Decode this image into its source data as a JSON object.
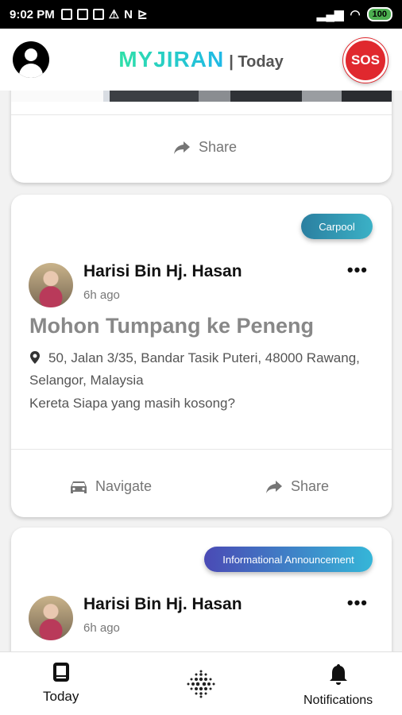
{
  "status_bar": {
    "time": "9:02 PM",
    "battery": "100"
  },
  "header": {
    "brand": "MYJIRAN",
    "section": "| Today",
    "sos_label": "SOS"
  },
  "feed": {
    "cards": [
      {
        "share_label": "Share"
      },
      {
        "tag": "Carpool",
        "author": "Harisi Bin Hj. Hasan",
        "time_ago": "6h ago",
        "title": "Mohon Tumpang ke Peneng",
        "address": "50, Jalan 3/35, Bandar Tasik Puteri, 48000 Rawang, Selangor, Malaysia",
        "body": "Kereta Siapa yang masih kosong?",
        "navigate_label": "Navigate",
        "share_label": "Share"
      },
      {
        "tag": "Informational Announcement",
        "author": "Harisi Bin Hj. Hasan",
        "time_ago": "6h ago"
      }
    ]
  },
  "bottom_nav": {
    "today_label": "Today",
    "notifications_label": "Notifications"
  },
  "colors": {
    "sos": "#e0282e",
    "brand_start": "#2fe0a8",
    "brand_end": "#1fb8e8"
  }
}
